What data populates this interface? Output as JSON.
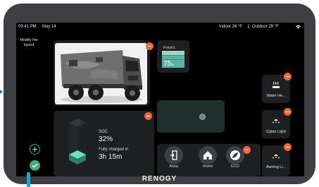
{
  "status": {
    "time": "09:41 PM",
    "date": "May 14",
    "indoor": "Indoor 26 °F",
    "outdoor": "Outdoor 29 °F",
    "divider": "|"
  },
  "sidebar": {
    "modify_label": "Modify the layout"
  },
  "fresh_tank": {
    "title": "Fresh1",
    "value": "75",
    "unit": "%",
    "level": 0.75
  },
  "battery": {
    "soc_label": "SOC",
    "soc_value": "32%",
    "soc_level": 0.32,
    "charged_label": "Fully charged in",
    "charged_value": "3h 15m"
  },
  "modes": [
    {
      "label": "Away",
      "icon": "away-door-icon"
    },
    {
      "label": "Home",
      "icon": "home-icon"
    },
    {
      "label": "ECO",
      "icon": "eco-leaf-icon"
    }
  ],
  "tiles": [
    {
      "label": "Water He...",
      "icon": "water-heater-icon"
    },
    {
      "label": "Cabin Light",
      "icon": "light-icon"
    },
    {
      "label": "Awning Li...",
      "icon": "light-icon"
    }
  ],
  "brand": "RENOGY",
  "colors": {
    "accent_orange": "#f0653a",
    "accent_green": "#3fae7a",
    "teal": "#5bc0b0",
    "bezel": "#3d3f43"
  }
}
